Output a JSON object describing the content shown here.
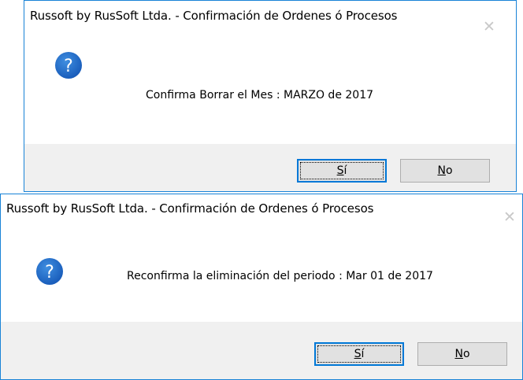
{
  "dialogs": [
    {
      "title": "Russoft by RusSoft Ltda. - Confirmación de Ordenes ó Procesos",
      "close_label": "✕",
      "icon": "question-icon",
      "message": "Confirma Borrar el Mes : MARZO de 2017",
      "yes": {
        "mnemonic": "S",
        "rest": "í"
      },
      "no": {
        "mnemonic": "N",
        "rest": "o"
      }
    },
    {
      "title": "Russoft by RusSoft Ltda. - Confirmación de Ordenes ó Procesos",
      "close_label": "✕",
      "icon": "question-icon",
      "message": "Reconfirma la eliminación del periodo : Mar 01 de 2017",
      "yes": {
        "mnemonic": "S",
        "rest": "í"
      },
      "no": {
        "mnemonic": "N",
        "rest": "o"
      }
    }
  ],
  "colors": {
    "accent_border": "#1883d7",
    "icon_blue": "#1a66c7",
    "footer_bg": "#f0f0f0",
    "button_bg": "#e1e1e1",
    "default_button_border": "#0078d7"
  }
}
